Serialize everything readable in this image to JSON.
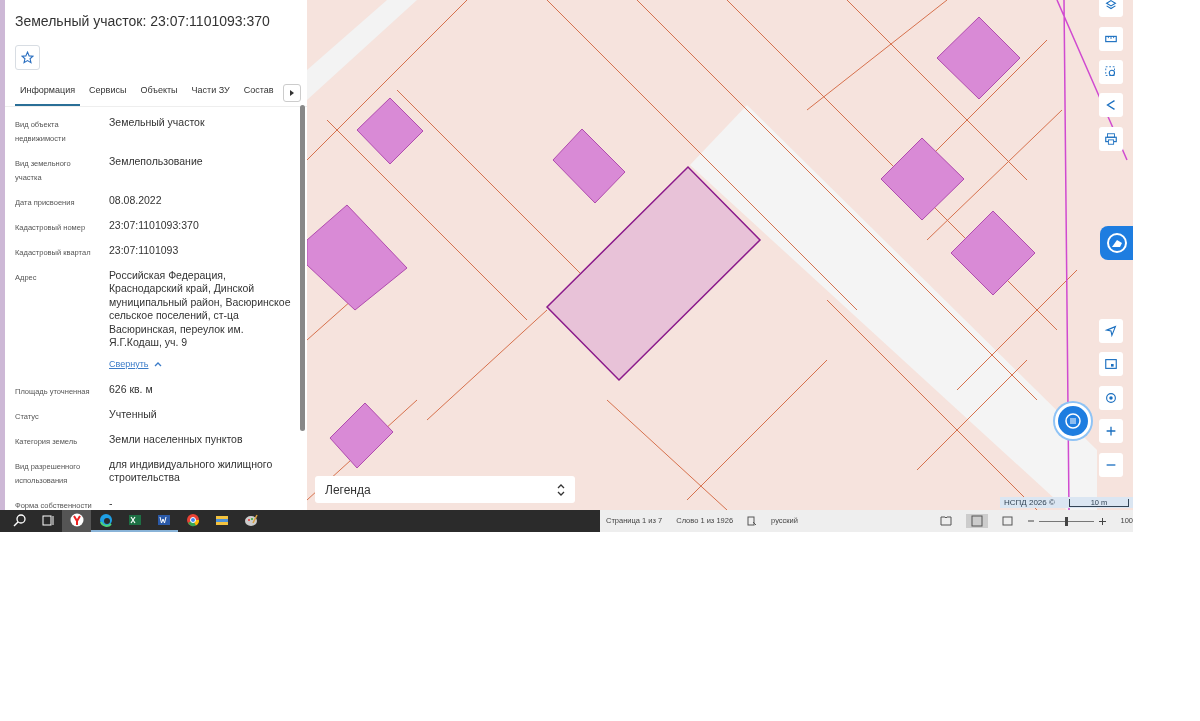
{
  "panel": {
    "title": "Земельный участок: 23:07:1101093:370",
    "tabs": [
      {
        "label": "Информация",
        "selected": true
      },
      {
        "label": "Сервисы",
        "selected": false
      },
      {
        "label": "Объекты",
        "selected": false
      },
      {
        "label": "Части ЗУ",
        "selected": false
      },
      {
        "label": "Состав",
        "selected": false
      }
    ],
    "fields": [
      {
        "label": "Вид объекта недвижимости",
        "value": "Земельный участок"
      },
      {
        "label": "Вид земельного участка",
        "value": "Землепользование"
      },
      {
        "label": "Дата присвоения",
        "value": "08.08.2022"
      },
      {
        "label": "Кадастровый номер",
        "value": "23:07:1101093:370"
      },
      {
        "label": "Кадастровый квартал",
        "value": "23:07:1101093"
      },
      {
        "label": "Адрес",
        "value": "Российская Федерация, Краснодарский край, Динской муниципальный район, Васюринское сельское поселений, ст-ца Васюринская, переулок им. Я.Г.Кодаш, уч. 9",
        "link": "Свернуть"
      },
      {
        "label": "Площадь уточненная",
        "value": "626 кв. м"
      },
      {
        "label": "Статус",
        "value": "Учтенный"
      },
      {
        "label": "Категория земель",
        "value": "Земли населенных пунктов"
      },
      {
        "label": "Вид разрешенного использования",
        "value": "для индивидуального жилищного строительства"
      },
      {
        "label": "Форма собственности",
        "value": "-"
      }
    ]
  },
  "map": {
    "legend": "Легенда",
    "attribution": "НСПД 2026 ©",
    "scale": "10 m"
  },
  "taskbar": {
    "apps": [
      {
        "kind": "search",
        "running": false,
        "selected": false
      },
      {
        "kind": "taskview",
        "running": false,
        "selected": false
      },
      {
        "kind": "yandex",
        "running": false,
        "selected": true
      },
      {
        "kind": "edge",
        "running": true,
        "selected": false
      },
      {
        "kind": "excel",
        "running": true,
        "selected": false
      },
      {
        "kind": "word",
        "running": true,
        "selected": false
      },
      {
        "kind": "chrome",
        "running": false,
        "selected": false
      },
      {
        "kind": "explorer",
        "running": false,
        "selected": false
      },
      {
        "kind": "paint",
        "running": false,
        "selected": false
      }
    ]
  },
  "status_bar": {
    "page": "Страница 1 из 7",
    "words": "Слово 1 из 1926",
    "language": "русский",
    "zoom": "100",
    "zoom_slider": {
      "level": 0.5
    }
  }
}
